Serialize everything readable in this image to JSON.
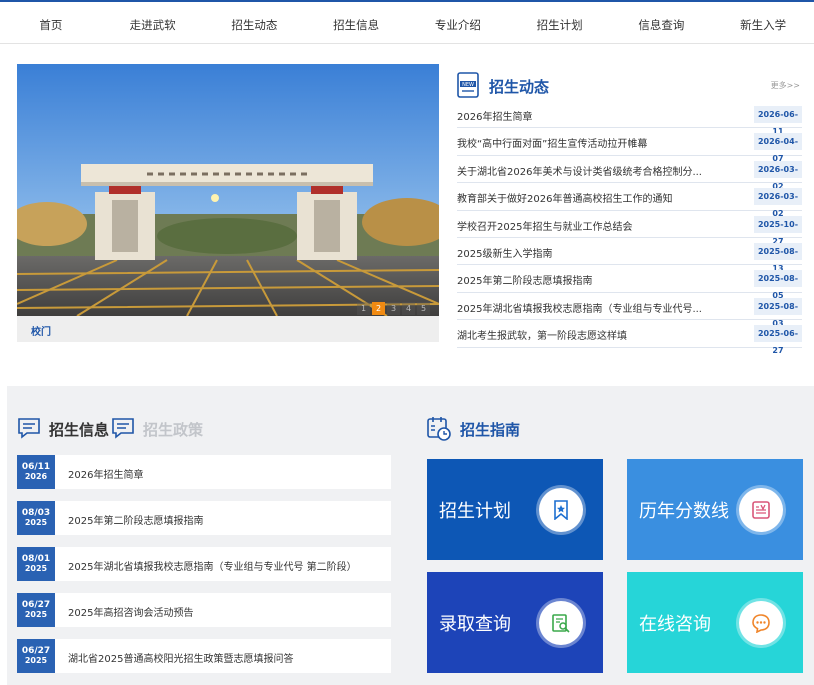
{
  "nav": [
    "首页",
    "走进武软",
    "招生动态",
    "招生信息",
    "专业介绍",
    "招生计划",
    "信息查询",
    "新生入学"
  ],
  "slider": {
    "caption": "校门",
    "pages": [
      "1",
      "2",
      "3",
      "4",
      "5"
    ],
    "active_page": 2
  },
  "news": {
    "title": "招生动态",
    "more": "更多>>",
    "items": [
      {
        "text": "2026年招生简章",
        "date": "2026-06-11"
      },
      {
        "text": "我校“高中行面对面”招生宣传活动拉开帷幕",
        "date": "2026-04-07"
      },
      {
        "text": "关于湖北省2026年美术与设计类省级统考合格控制分...",
        "date": "2026-03-02"
      },
      {
        "text": "教育部关于做好2026年普通高校招生工作的通知",
        "date": "2026-03-02"
      },
      {
        "text": "学校召开2025年招生与就业工作总结会",
        "date": "2025-10-27"
      },
      {
        "text": "2025级新生入学指南",
        "date": "2025-08-13"
      },
      {
        "text": "2025年第二阶段志愿填报指南",
        "date": "2025-08-05"
      },
      {
        "text": "2025年湖北省填报我校志愿指南（专业组与专业代号...",
        "date": "2025-08-03"
      },
      {
        "text": "湖北考生报武软，第一阶段志愿这样填",
        "date": "2025-06-27"
      }
    ]
  },
  "info": {
    "tab_active": "招生信息",
    "tab_inactive": "招生政策",
    "items": [
      {
        "md": "06/11",
        "y": "2026",
        "text": "2026年招生简章"
      },
      {
        "md": "08/03",
        "y": "2025",
        "text": "2025年第二阶段志愿填报指南"
      },
      {
        "md": "08/01",
        "y": "2025",
        "text": "2025年湖北省填报我校志愿指南（专业组与专业代号 第二阶段）"
      },
      {
        "md": "06/27",
        "y": "2025",
        "text": "2025年高招咨询会活动预告"
      },
      {
        "md": "06/27",
        "y": "2025",
        "text": "湖北省2025普通高校阳光招生政策暨志愿填报问答"
      }
    ]
  },
  "guide": {
    "title": "招生指南",
    "cards": [
      {
        "label": "招生计划",
        "icon": "bookmark-icon",
        "color": "#0d57b5"
      },
      {
        "label": "历年分数线",
        "icon": "document-icon",
        "color": "#3a8fe0"
      },
      {
        "label": "录取查询",
        "icon": "search-doc-icon",
        "color": "#1d44b8"
      },
      {
        "label": "在线咨询",
        "icon": "chat-icon",
        "color": "#26d5d8"
      }
    ]
  }
}
